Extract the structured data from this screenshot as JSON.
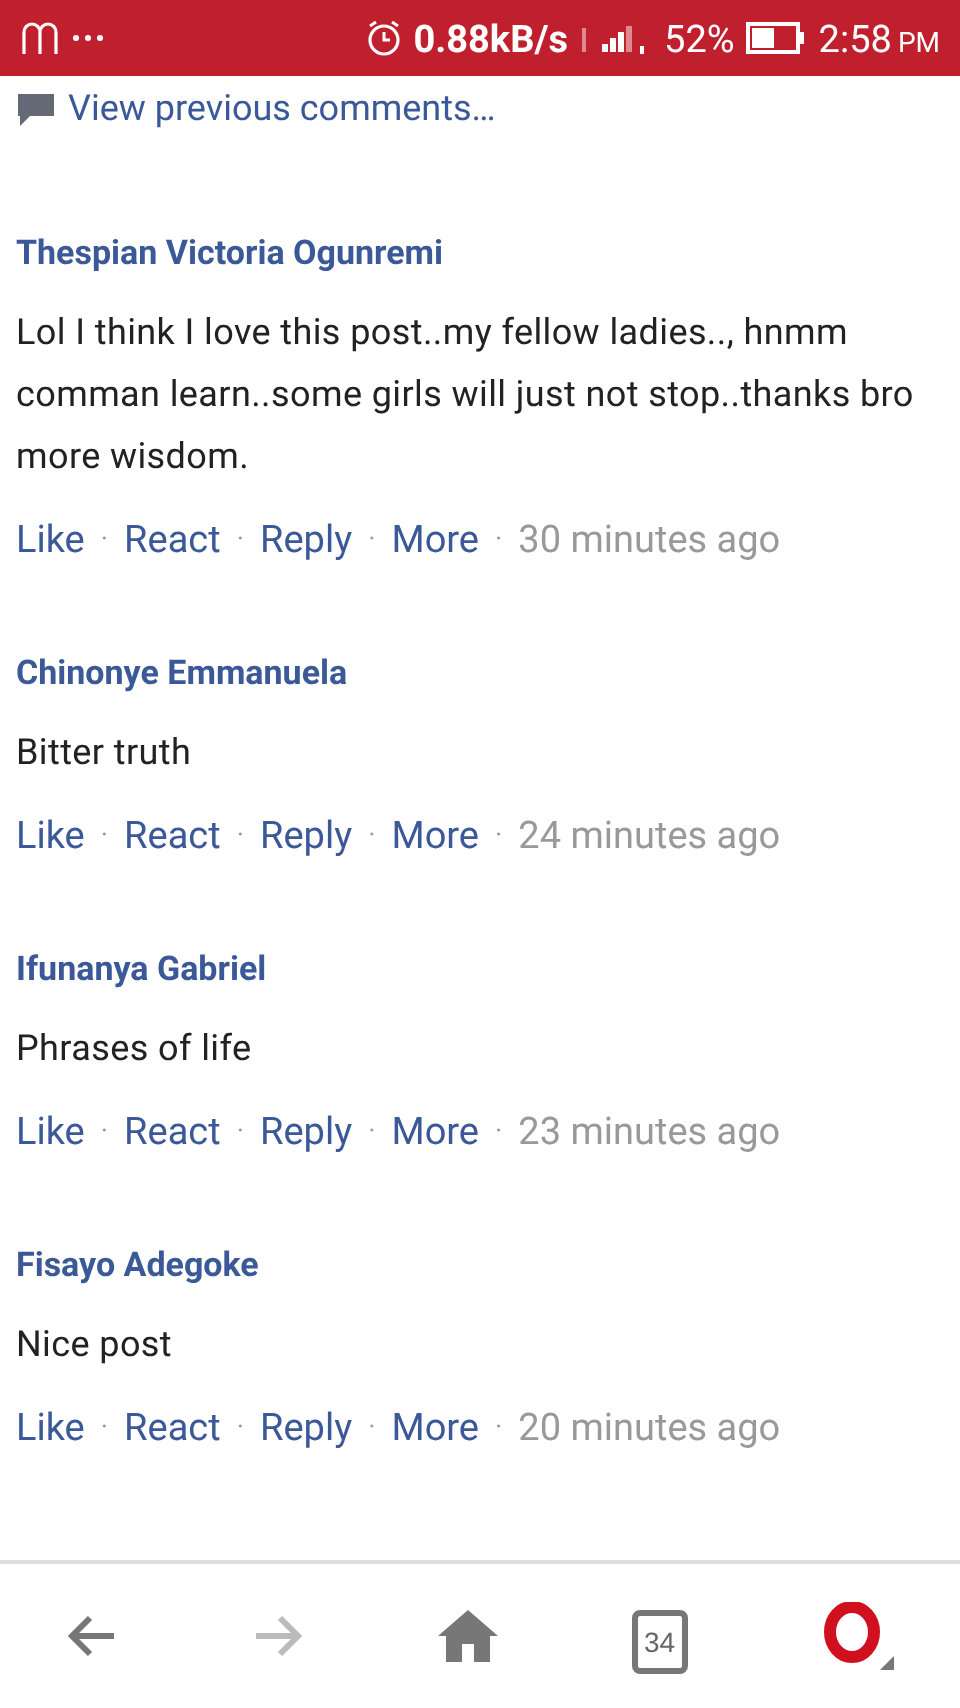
{
  "status_bar": {
    "speed": "0.88kB/s",
    "battery": "52%",
    "time": "2:58",
    "ampm": "PM"
  },
  "view_previous": "View previous comments…",
  "separator": "·",
  "comments": [
    {
      "author": "Thespian Victoria Ogunremi",
      "text": "Lol I think I love this post..my fellow ladies.., hnmm comman learn..some girls will just not stop..thanks bro more wisdom.",
      "actions": [
        "Like",
        "React",
        "Reply",
        "More"
      ],
      "time": "30 minutes ago"
    },
    {
      "author": "Chinonye Emmanuela",
      "text": "Bitter truth",
      "actions": [
        "Like",
        "React",
        "Reply",
        "More"
      ],
      "time": "24 minutes ago"
    },
    {
      "author": "Ifunanya Gabriel",
      "text": "Phrases of life",
      "actions": [
        "Like",
        "React",
        "Reply",
        "More"
      ],
      "time": "23 minutes ago"
    },
    {
      "author": "Fisayo Adegoke",
      "text": "Nice post",
      "actions": [
        "Like",
        "React",
        "Reply",
        "More"
      ],
      "time": "20 minutes ago"
    }
  ],
  "nav": [
    {
      "kind": "back",
      "disabled": false
    },
    {
      "kind": "forward",
      "disabled": true
    },
    {
      "kind": "home",
      "disabled": false
    },
    {
      "kind": "tabs",
      "count": "34",
      "disabled": false
    },
    {
      "kind": "opera",
      "disabled": false
    }
  ]
}
